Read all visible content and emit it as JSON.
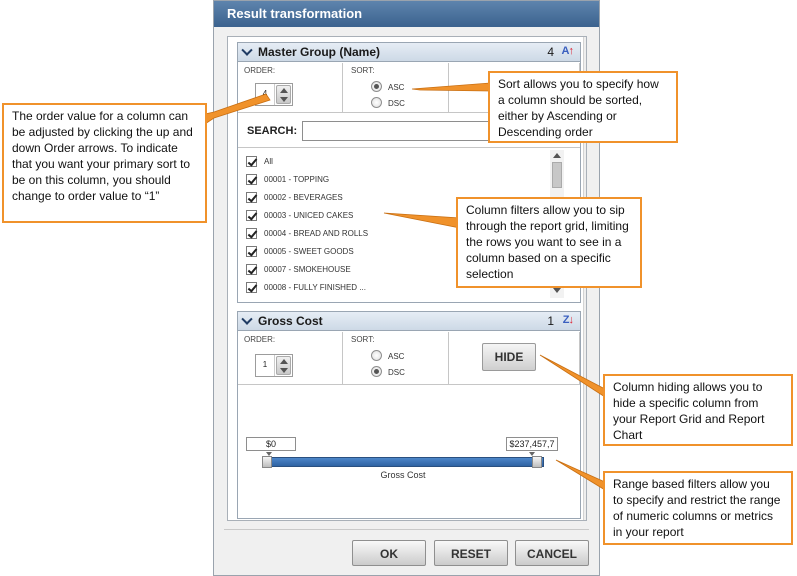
{
  "dialog": {
    "title": "Result transformation",
    "buttons": {
      "ok": "OK",
      "reset": "RESET",
      "cancel": "CANCEL"
    }
  },
  "master_group": {
    "title": "Master Group (Name)",
    "count": "4",
    "order_label": "ORDER:",
    "order_value": "4",
    "sort_label": "SORT:",
    "sort_options": {
      "asc": "ASC",
      "dsc": "DSC"
    },
    "sort_selected": "ASC",
    "search_label": "SEARCH:",
    "search_value": "",
    "items": [
      "All",
      "00001 - TOPPING",
      "00002 - BEVERAGES",
      "00003 - UNICED CAKES",
      "00004 - BREAD AND ROLLS",
      "00005 - SWEET GOODS",
      "00007 - SMOKEHOUSE",
      "00008 - FULLY FINISHED ..."
    ]
  },
  "gross_cost": {
    "title": "Gross Cost",
    "count": "1",
    "order_label": "ORDER:",
    "order_value": "1",
    "sort_label": "SORT:",
    "sort_options": {
      "asc": "ASC",
      "dsc": "DSC"
    },
    "sort_selected": "DSC",
    "hide_label": "HIDE",
    "range_min": "$0",
    "range_max": "$237,457,7",
    "range_caption": "Gross Cost"
  },
  "callouts": {
    "order": "The order value for a column can be adjusted by clicking the up and down Order arrows. To indicate that you want your primary sort to be on this column, you should change to order value to “1”",
    "sort": "Sort allows you to specify how a column should be sorted, either by Ascending or Descending order",
    "filter": "Column filters allow you to sip through the report grid, limiting the rows you want to see in a column based on a specific selection",
    "hide": "Column hiding allows you to hide a specific column from your Report Grid and Report Chart",
    "range": "Range based filters allow you to specify and restrict the range of numeric columns or metrics in your report"
  },
  "colors": {
    "callout_border": "#f0922b",
    "title_bar": "#3b628e",
    "range_track": "#2f63a3"
  }
}
